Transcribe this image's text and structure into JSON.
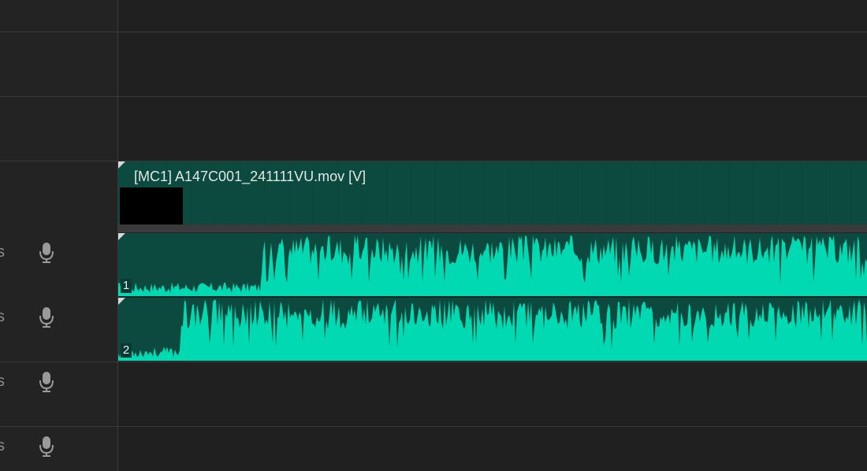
{
  "timeline": {
    "video_clip": {
      "title": "[MC1] A147C001_241111VU.mov [V]"
    },
    "audio_tracks": [
      {
        "glyph": "s",
        "icon": "microphone-icon",
        "clip_label": "1"
      },
      {
        "glyph": "s",
        "icon": "microphone-icon",
        "clip_label": "2"
      },
      {
        "glyph": "s",
        "icon": "microphone-icon"
      },
      {
        "glyph": "s",
        "icon": "microphone-icon"
      }
    ],
    "colors": {
      "clip_bg": "#0c4a40",
      "waveform": "#00d9b1",
      "panel_bg": "#232323"
    }
  }
}
